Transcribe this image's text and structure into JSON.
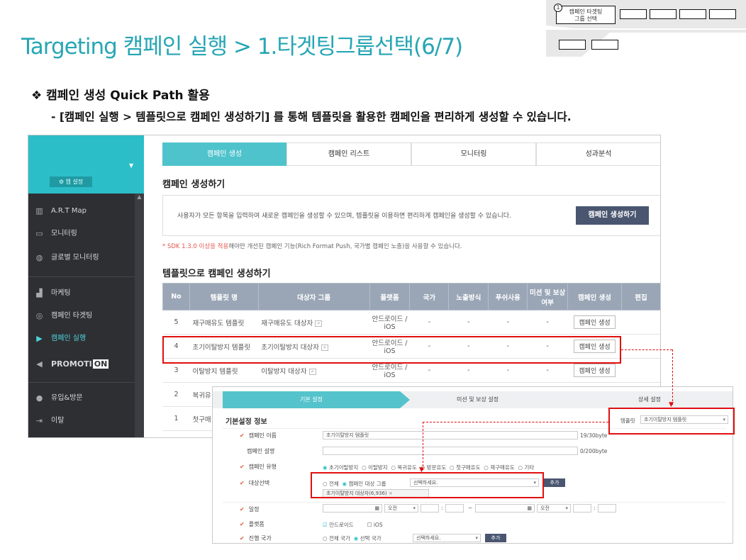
{
  "slide": {
    "title": "Targeting 캠페인 실행 > 1.타겟팅그룹선택(6/7)",
    "bullet": "❖   캠페인 생성 Quick Path 활용",
    "subline": "-  [캠페인 실행 > 템플릿으로 캠페인 생성하기] 를 통해 템플릿을 활용한 캠페인을 편리하게 생성할 수 있습니다.",
    "nav_step_num": "1",
    "nav_step_label_1": "캠페인 타겟팅",
    "nav_step_label_2": "그룹 선택"
  },
  "sidebar": {
    "app_settings": "⚙ 앱 설정",
    "items": [
      {
        "label": "A.R.T Map",
        "icon": "chart-icon"
      },
      {
        "label": "모니터링",
        "icon": "monitor-icon"
      },
      {
        "label": "글로벌 모니터링",
        "icon": "globe-icon"
      },
      {
        "label": "마케팅",
        "icon": "bar-chart-icon"
      },
      {
        "label": "캠페인 타겟팅",
        "icon": "target-icon"
      },
      {
        "label": "캠페인 실행",
        "icon": "play-icon"
      },
      {
        "label": "PROMOTI",
        "badge": "ON",
        "icon": "megaphone-icon"
      },
      {
        "label": "유입&방문",
        "icon": "user-icon"
      },
      {
        "label": "이탈",
        "icon": "exit-icon"
      }
    ]
  },
  "tabs": [
    "캠페인 생성",
    "캠페인 리스트",
    "모니터링",
    "성과분석"
  ],
  "create_section": {
    "title": "캠페인 생성하기",
    "info": "사용자가 모든 항목을 입력하여 새로운 캠페인을 생성할 수 있으며, 템플릿을 이용하면 편리하게 캠페인을 생성할 수 있습니다.",
    "button": "캠페인 생성하기",
    "note_red": "* SDK 1.3.0 이상을 적용",
    "note_rest": "해야만 개선된 캠페인 기능(Rich Format Push, 국가별 캠페인 노출)을 사용할 수 있습니다."
  },
  "template_section": {
    "title": "템플릿으로 캠페인 생성하기",
    "headers": [
      "No",
      "템플릿 명",
      "대상자 그룹",
      "플랫폼",
      "국가",
      "노출방식",
      "푸쉬사용",
      "미션 및 보상 여부",
      "캠페인 생성",
      "편집"
    ],
    "rows": [
      {
        "no": "5",
        "name": "재구매유도 템플릿",
        "group": "재구매유도 대상자",
        "platform": "안드로이드 / iOS",
        "country": "-",
        "exposure": "-",
        "push": "-",
        "mission": "-",
        "action": "캠페인 생성"
      },
      {
        "no": "4",
        "name": "초기이탈방지 템플릿",
        "group": "초기이탈방지 대상자",
        "platform": "안드로이드 / iOS",
        "country": "-",
        "exposure": "-",
        "push": "-",
        "mission": "-",
        "action": "캠페인 생성"
      },
      {
        "no": "3",
        "name": "이탈방지 템플릿",
        "group": "이탈방지 대상자",
        "platform": "안드로이드 / iOS",
        "country": "-",
        "exposure": "-",
        "push": "-",
        "mission": "-",
        "action": "캠페인 생성"
      },
      {
        "no": "2",
        "name": "복귀유"
      },
      {
        "no": "1",
        "name": "첫구매"
      }
    ]
  },
  "overlay": {
    "steps": [
      "기본 설정",
      "미션 및 보상 설정",
      "상세 설정"
    ],
    "section_title": "기본설정 정보",
    "template_label": "템플릿",
    "template_value": "초기이탈방지 템플릿",
    "fields": {
      "name_label": "캠페인 이름",
      "name_value": "초기이탈방지 템플릿",
      "name_count": "19/30byte",
      "desc_label": "캠페인 설명",
      "desc_count": "0/200byte",
      "type_label": "캠페인 유형",
      "type_options": [
        "초기이탈방지",
        "이탈방지",
        "복귀유도",
        "방문유도",
        "첫구매유도",
        "재구매유도",
        "기타"
      ],
      "target_label": "대상선택",
      "target_all": "전체",
      "target_group": "캠페인 대상 그룹",
      "target_select_placeholder": "선택하세요.",
      "target_add": "추가",
      "target_chip": "초기이탈방지 대상자(6,936)",
      "schedule_label": "일정",
      "am_pm": "오전",
      "platform_label": "플랫폼",
      "platform_android": "안드로이드",
      "platform_ios": "iOS",
      "country_label": "진행 국가",
      "country_all": "전체 국가",
      "country_select": "선택 국가",
      "country_placeholder": "선택하세요.",
      "country_add": "추가"
    }
  }
}
